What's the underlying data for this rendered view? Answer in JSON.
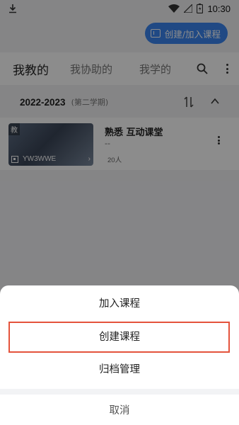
{
  "status_bar": {
    "time": "10:30"
  },
  "top_action": {
    "label": "创建/加入课程"
  },
  "tabs": [
    {
      "label": "我教的",
      "active": true
    },
    {
      "label": "我协助的",
      "active": false
    },
    {
      "label": "我学的",
      "active": false
    }
  ],
  "semester": {
    "year": "2022-2023",
    "term": "(第二学期)"
  },
  "course": {
    "tag": "教",
    "code": "YW3WWE",
    "name": "熟悉 互动课堂",
    "teacher": "--",
    "count": "20人"
  },
  "sheet": {
    "items": [
      "加入课程",
      "创建课程",
      "归档管理"
    ],
    "cancel": "取消"
  },
  "colors": {
    "accent": "#3b86f0",
    "highlight": "#e4533c"
  }
}
